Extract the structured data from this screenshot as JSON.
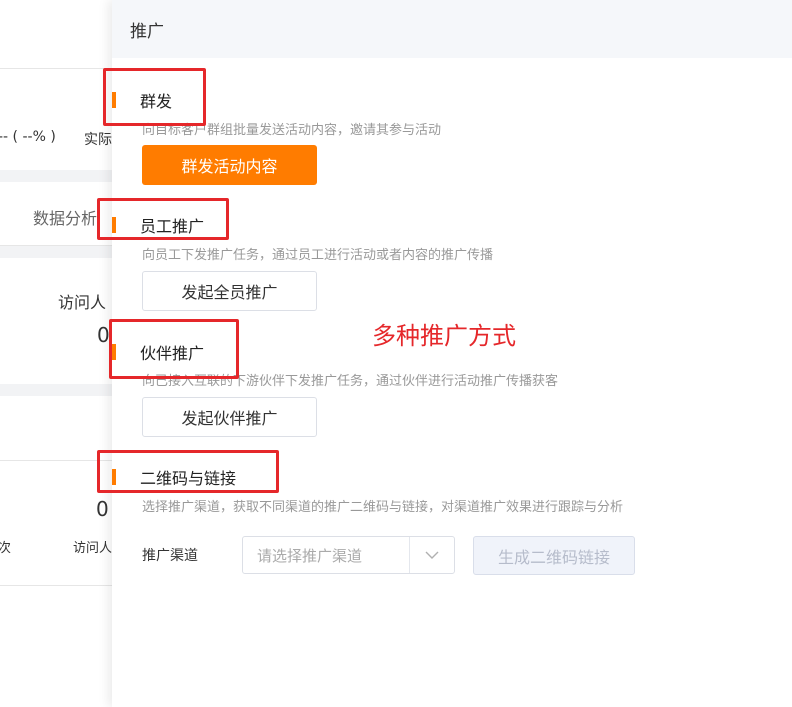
{
  "background": {
    "percent_text": "-- ( --% )",
    "actual_text": "实际",
    "data_tab": "数据分析",
    "visitors_label": "访问人",
    "visitors_value_1": "0",
    "visitors_value_2": "0",
    "bottom_left_text": "次",
    "bottom_visitors_label": "访问人"
  },
  "drawer": {
    "title": "推广",
    "sections": [
      {
        "title": "群发",
        "desc": "向目标客户群组批量发送活动内容，邀请其参与活动",
        "button": "群发活动内容"
      },
      {
        "title": "员工推广",
        "desc": "向员工下发推广任务，通过员工进行活动或者内容的推广传播",
        "button": "发起全员推广"
      },
      {
        "title": "伙伴推广",
        "desc": "向已接入互联的下游伙伴下发推广任务，通过伙伴进行活动推广传播获客",
        "button": "发起伙伴推广"
      },
      {
        "title": "二维码与链接",
        "desc": "选择推广渠道，获取不同渠道的推广二维码与链接，对渠道推广效果进行跟踪与分析"
      }
    ],
    "channel_label": "推广渠道",
    "channel_placeholder": "请选择推广渠道",
    "generate_button": "生成二维码链接",
    "annotation": "多种推广方式"
  },
  "colors": {
    "accent": "#ff7c00",
    "annotation_red": "#e5272a"
  },
  "icons": {
    "select_arrow": "chevron-down-icon"
  }
}
